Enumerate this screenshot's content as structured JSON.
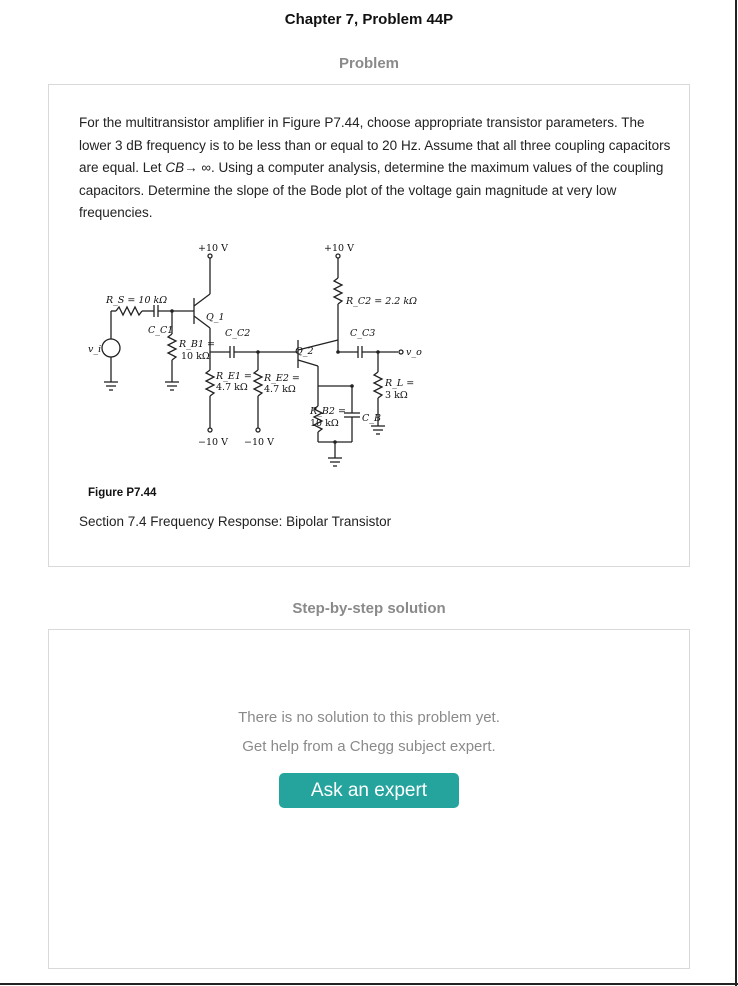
{
  "page": {
    "title": "Chapter 7, Problem 44P"
  },
  "problem": {
    "heading": "Problem",
    "text_before_cb": "For the multitransistor amplifier in Figure P7.44, choose appropriate transistor parameters. The lower 3 dB frequency is to be less than or equal to 20 Hz. Assume that all three coupling capacitors are equal. Let ",
    "cb_symbol": "CB",
    "text_after_cb": "→ ∞. Using a computer analysis, determine the maximum values of the coupling capacitors. Determine the slope of the Bode plot of the voltage gain magnitude at very low frequencies.",
    "figure_caption": "Figure P7.44",
    "section": "Section 7.4 Frequency Response: Bipolar Transistor"
  },
  "circuit": {
    "vcc1": "+10 V",
    "vcc2": "+10 V",
    "rs": "R_S = 10 kΩ",
    "cc1": "C_C1",
    "q1": "Q_1",
    "cc2": "C_C2",
    "rb1_a": "R_B1 =",
    "rb1_b": "10 kΩ",
    "re1_a": "R_E1 =",
    "re1_b": "4.7 kΩ",
    "re2_a": "R_E2 =",
    "re2_b": "4.7 kΩ",
    "vee1": "−10 V",
    "vee2": "−10 V",
    "q2": "Q_2",
    "rc2": "R_C2 = 2.2 kΩ",
    "cc3": "C_C3",
    "vo": "v_o",
    "vi": "v_i",
    "rl_a": "R_L =",
    "rl_b": "3 kΩ",
    "rb2_a": "R_B2 =",
    "rb2_b": "10 kΩ",
    "cb": "C_B"
  },
  "solution": {
    "heading": "Step-by-step solution",
    "no_solution": "There is no solution to this problem yet.",
    "get_help": "Get help from a Chegg subject expert.",
    "ask_button": "Ask an expert"
  },
  "colors": {
    "accent": "#24a49d",
    "muted_text": "#8a8a8a",
    "card_border": "#d9d9d9"
  }
}
